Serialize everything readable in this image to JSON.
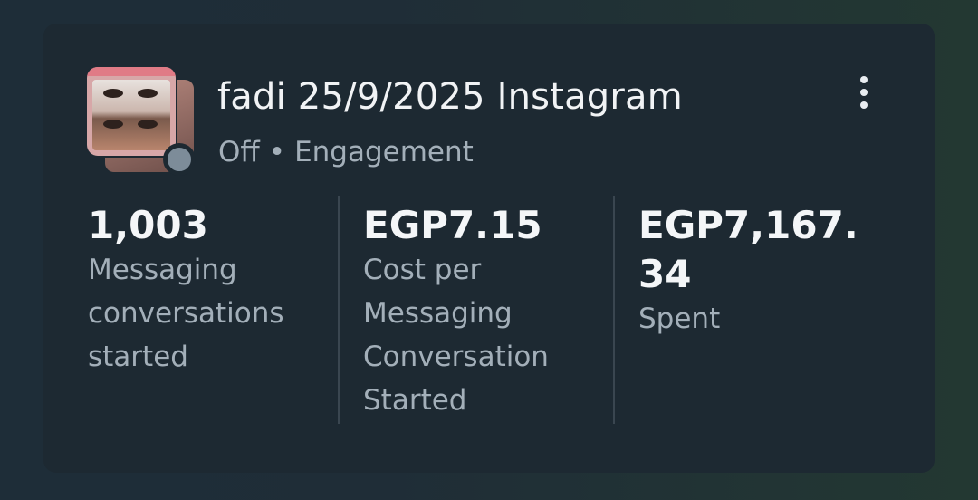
{
  "campaign": {
    "title": "fadi 25/9/2025 Instagram",
    "status": "Off",
    "separator": "•",
    "objective": "Engagement"
  },
  "metrics": [
    {
      "value": "1,003",
      "label": "Messaging conversations started"
    },
    {
      "value": "EGP7.15",
      "label": "Cost per Messaging Conversation Started"
    },
    {
      "value": "EGP7,167.34",
      "label": "Spent"
    }
  ],
  "icons": {
    "menu": "more-vertical-icon",
    "status": "status-dot"
  },
  "colors": {
    "card_background": "#1d2932",
    "status_off": "#7d8c99"
  }
}
